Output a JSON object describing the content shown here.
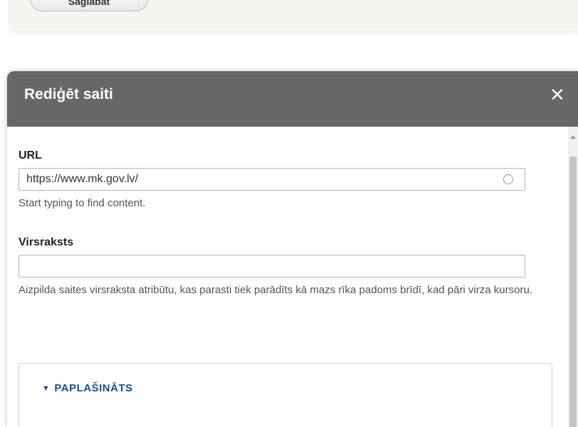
{
  "top_panel": {
    "save_label": "Saglabāt"
  },
  "dialog": {
    "title": "Rediģēt saiti",
    "close_symbol": "✕",
    "url": {
      "label": "URL",
      "value": "https://www.mk.gov.lv/",
      "help": "Start typing to find content."
    },
    "title_field": {
      "label": "Virsraksts",
      "value": "",
      "help": "Aizpilda saites virsraksta atribūtu, kas parasti tiek parādīts kā mazs rīka padoms brīdī, kad pāri virza kursoru."
    },
    "advanced": {
      "arrow": "▼",
      "label": "PAPLAŠINĀTS"
    }
  },
  "colors": {
    "titlebar": "#676767",
    "link_blue": "#1a4d8f",
    "panel_bg": "#f5f5f2"
  }
}
